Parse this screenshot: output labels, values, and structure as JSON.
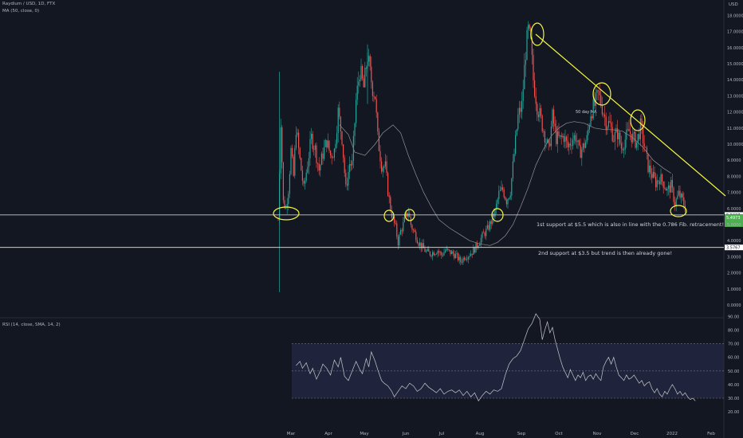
{
  "header": {
    "symbol": "Raydium / USD, 1D, FTX",
    "ma_label": "MA (50, close, 0)",
    "currency": "USD",
    "rsi_label": "RSI (14, close, SMA, 14, 2)"
  },
  "colors": {
    "up": "#26a69a",
    "down": "#ef5350",
    "background": "#131722",
    "trendline": "#f5f541",
    "ma": "#a8a8a8",
    "rsi": "#c9c9c9",
    "rsi_band": "#2a2e52",
    "price_badge": "#4caf50"
  },
  "chart_data": [
    {
      "type": "candlestick",
      "x_ticks": [
        "Mar",
        "Apr",
        "May",
        "Jun",
        "Jul",
        "Aug",
        "Sep",
        "Oct",
        "Nov",
        "Dec",
        "2022",
        "Feb"
      ],
      "y_ticks": [
        "0.0000",
        "1.0000",
        "2.0000",
        "3.0000",
        "4.0000",
        "5.0000",
        "6.0000",
        "7.0000",
        "8.0000",
        "9.0000",
        "10.0000",
        "11.0000",
        "12.0000",
        "13.0000",
        "14.0000",
        "15.0000",
        "16.0000",
        "17.0000",
        "18.0000"
      ],
      "ylim": [
        0,
        18.5
      ],
      "close_points": [
        [
          0,
          5.3
        ],
        [
          2,
          11.5
        ],
        [
          4,
          6.4
        ],
        [
          6,
          6.0
        ],
        [
          8,
          7.2
        ],
        [
          10,
          9.6
        ],
        [
          12,
          8.0
        ],
        [
          14,
          11.0
        ],
        [
          17,
          9.0
        ],
        [
          20,
          7.2
        ],
        [
          23,
          8.8
        ],
        [
          26,
          10.4
        ],
        [
          29,
          9.7
        ],
        [
          32,
          8.4
        ],
        [
          35,
          9.4
        ],
        [
          38,
          10.2
        ],
        [
          41,
          9.3
        ],
        [
          44,
          9.6
        ],
        [
          47,
          12.0
        ],
        [
          50,
          10.4
        ],
        [
          53,
          7.2
        ],
        [
          56,
          8.8
        ],
        [
          58,
          8.7
        ],
        [
          61,
          12.7
        ],
        [
          64,
          14.6
        ],
        [
          67,
          13.5
        ],
        [
          70,
          15.5
        ],
        [
          72,
          14.4
        ],
        [
          74,
          13.5
        ],
        [
          76,
          13.0
        ],
        [
          78,
          10.4
        ],
        [
          81,
          8.7
        ],
        [
          84,
          8.6
        ],
        [
          86,
          7.1
        ],
        [
          88,
          6.0
        ],
        [
          90,
          5.3
        ],
        [
          92,
          4.8
        ],
        [
          94,
          3.9
        ],
        [
          96,
          4.6
        ],
        [
          98,
          5.0
        ],
        [
          100,
          5.5
        ],
        [
          102,
          5.8
        ],
        [
          104,
          5.0
        ],
        [
          106,
          4.6
        ],
        [
          108,
          4.3
        ],
        [
          110,
          3.9
        ],
        [
          113,
          3.6
        ],
        [
          116,
          3.3
        ],
        [
          119,
          3.2
        ],
        [
          122,
          3.3
        ],
        [
          125,
          3.4
        ],
        [
          128,
          3.1
        ],
        [
          131,
          3.4
        ],
        [
          134,
          3.3
        ],
        [
          137,
          3.2
        ],
        [
          140,
          3.0
        ],
        [
          143,
          2.7
        ],
        [
          146,
          3.0
        ],
        [
          149,
          3.1
        ],
        [
          152,
          3.3
        ],
        [
          155,
          3.6
        ],
        [
          158,
          4.0
        ],
        [
          161,
          4.4
        ],
        [
          164,
          4.7
        ],
        [
          167,
          5.2
        ],
        [
          170,
          5.8
        ],
        [
          173,
          6.9
        ],
        [
          176,
          7.2
        ],
        [
          179,
          6.5
        ],
        [
          182,
          7.1
        ],
        [
          185,
          9.4
        ],
        [
          188,
          11.7
        ],
        [
          191,
          12.4
        ],
        [
          194,
          15.8
        ],
        [
          196,
          17.0
        ],
        [
          198,
          16.2
        ],
        [
          200,
          14.0
        ],
        [
          203,
          12.4
        ],
        [
          206,
          11.5
        ],
        [
          209,
          10.6
        ],
        [
          212,
          9.6
        ],
        [
          215,
          11.7
        ],
        [
          218,
          10.4
        ],
        [
          221,
          10.3
        ],
        [
          224,
          10.5
        ],
        [
          227,
          9.8
        ],
        [
          230,
          10.3
        ],
        [
          233,
          10.5
        ],
        [
          236,
          9.5
        ],
        [
          239,
          9.8
        ],
        [
          242,
          10.3
        ],
        [
          245,
          12.0
        ],
        [
          248,
          12.4
        ],
        [
          251,
          13.1
        ],
        [
          254,
          12.3
        ],
        [
          257,
          11.4
        ],
        [
          260,
          11.2
        ],
        [
          263,
          10.4
        ],
        [
          266,
          10.7
        ],
        [
          269,
          9.8
        ],
        [
          272,
          10.3
        ],
        [
          275,
          10.8
        ],
        [
          278,
          10.4
        ],
        [
          281,
          10.1
        ],
        [
          284,
          11.1
        ],
        [
          287,
          9.9
        ],
        [
          290,
          8.6
        ],
        [
          293,
          8.1
        ],
        [
          296,
          7.6
        ],
        [
          299,
          7.9
        ],
        [
          302,
          7.6
        ],
        [
          305,
          7.1
        ],
        [
          308,
          7.4
        ],
        [
          311,
          6.3
        ],
        [
          314,
          6.9
        ],
        [
          317,
          6.5
        ],
        [
          320,
          5.8
        ]
      ],
      "ma50": [
        [
          48,
          11.2
        ],
        [
          55,
          10.6
        ],
        [
          60,
          9.5
        ],
        [
          68,
          9.3
        ],
        [
          76,
          10.0
        ],
        [
          82,
          10.7
        ],
        [
          90,
          11.2
        ],
        [
          96,
          10.7
        ],
        [
          102,
          9.3
        ],
        [
          108,
          8.1
        ],
        [
          114,
          7.0
        ],
        [
          120,
          6.1
        ],
        [
          126,
          5.3
        ],
        [
          134,
          4.8
        ],
        [
          142,
          4.4
        ],
        [
          150,
          4.0
        ],
        [
          158,
          3.8
        ],
        [
          166,
          3.7
        ],
        [
          172,
          3.9
        ],
        [
          178,
          4.3
        ],
        [
          184,
          5.0
        ],
        [
          190,
          6.1
        ],
        [
          196,
          7.3
        ],
        [
          202,
          8.7
        ],
        [
          208,
          9.7
        ],
        [
          214,
          10.5
        ],
        [
          220,
          11.0
        ],
        [
          226,
          11.3
        ],
        [
          232,
          11.4
        ],
        [
          240,
          11.3
        ],
        [
          248,
          11.0
        ],
        [
          256,
          10.9
        ],
        [
          262,
          10.9
        ],
        [
          270,
          10.8
        ],
        [
          278,
          10.4
        ],
        [
          286,
          9.8
        ],
        [
          294,
          9.0
        ],
        [
          302,
          8.5
        ],
        [
          308,
          8.2
        ]
      ],
      "ma_label": "50 day MA",
      "supports": [
        {
          "price_label": "5.5987",
          "text": "1st support at $5.5 which is also in line with the 0.786 Fib. retracement!"
        },
        {
          "price_label": "3.5767",
          "text": "2nd support at $3.5 but trend is then already gone!"
        }
      ],
      "last_price": "5.4973"
    },
    {
      "type": "line",
      "title": "RSI (14, close, SMA, 14, 2)",
      "y_ticks": [
        "20.00",
        "30.00",
        "40.00",
        "50.00",
        "60.00",
        "70.00",
        "80.00",
        "90.00"
      ],
      "ylim": [
        20,
        95
      ],
      "levels": [
        30,
        50,
        70
      ],
      "values": [
        [
          0,
          54
        ],
        [
          3,
          57
        ],
        [
          5,
          52
        ],
        [
          8,
          56
        ],
        [
          11,
          48
        ],
        [
          13,
          52
        ],
        [
          16,
          44
        ],
        [
          19,
          50
        ],
        [
          21,
          55
        ],
        [
          24,
          52
        ],
        [
          27,
          47
        ],
        [
          30,
          58
        ],
        [
          33,
          53
        ],
        [
          35,
          60
        ],
        [
          38,
          46
        ],
        [
          41,
          43
        ],
        [
          44,
          50
        ],
        [
          47,
          57
        ],
        [
          50,
          51
        ],
        [
          52,
          48
        ],
        [
          55,
          59
        ],
        [
          57,
          53
        ],
        [
          59,
          64
        ],
        [
          62,
          57
        ],
        [
          64,
          51
        ],
        [
          67,
          43
        ],
        [
          69,
          41
        ],
        [
          72,
          39
        ],
        [
          75,
          35
        ],
        [
          77,
          31
        ],
        [
          80,
          35
        ],
        [
          83,
          39
        ],
        [
          86,
          37
        ],
        [
          89,
          41
        ],
        [
          92,
          39
        ],
        [
          95,
          35
        ],
        [
          98,
          37
        ],
        [
          101,
          41
        ],
        [
          104,
          38
        ],
        [
          107,
          36
        ],
        [
          110,
          34
        ],
        [
          113,
          37
        ],
        [
          116,
          33
        ],
        [
          119,
          35
        ],
        [
          122,
          36
        ],
        [
          125,
          34
        ],
        [
          128,
          36
        ],
        [
          131,
          32
        ],
        [
          134,
          35
        ],
        [
          137,
          31
        ],
        [
          140,
          34
        ],
        [
          143,
          28
        ],
        [
          146,
          32
        ],
        [
          149,
          35
        ],
        [
          152,
          33
        ],
        [
          155,
          36
        ],
        [
          158,
          35
        ],
        [
          161,
          37
        ],
        [
          164,
          47
        ],
        [
          167,
          55
        ],
        [
          170,
          59
        ],
        [
          173,
          61
        ],
        [
          176,
          65
        ],
        [
          179,
          73
        ],
        [
          182,
          81
        ],
        [
          185,
          85
        ],
        [
          188,
          92
        ],
        [
          191,
          88
        ],
        [
          193,
          73
        ],
        [
          195,
          80
        ],
        [
          197,
          86
        ],
        [
          199,
          78
        ],
        [
          201,
          82
        ],
        [
          203,
          73
        ],
        [
          205,
          66
        ],
        [
          207,
          59
        ],
        [
          209,
          53
        ],
        [
          211,
          49
        ],
        [
          213,
          45
        ],
        [
          215,
          51
        ],
        [
          217,
          47
        ],
        [
          219,
          43
        ],
        [
          221,
          47
        ],
        [
          223,
          45
        ],
        [
          225,
          49
        ],
        [
          227,
          43
        ],
        [
          229,
          46
        ],
        [
          231,
          47
        ],
        [
          233,
          44
        ],
        [
          235,
          48
        ],
        [
          237,
          45
        ],
        [
          239,
          43
        ],
        [
          241,
          53
        ],
        [
          243,
          57
        ],
        [
          245,
          60
        ],
        [
          247,
          55
        ],
        [
          249,
          60
        ],
        [
          251,
          53
        ],
        [
          253,
          47
        ],
        [
          255,
          45
        ],
        [
          257,
          43
        ],
        [
          259,
          47
        ],
        [
          261,
          44
        ],
        [
          263,
          45
        ],
        [
          265,
          47
        ],
        [
          267,
          44
        ],
        [
          269,
          41
        ],
        [
          271,
          43
        ],
        [
          273,
          39
        ],
        [
          275,
          41
        ],
        [
          277,
          42
        ],
        [
          279,
          37
        ],
        [
          281,
          34
        ],
        [
          283,
          37
        ],
        [
          285,
          33
        ],
        [
          287,
          31
        ],
        [
          289,
          35
        ],
        [
          291,
          33
        ],
        [
          293,
          37
        ],
        [
          295,
          40
        ],
        [
          297,
          37
        ],
        [
          299,
          33
        ],
        [
          301,
          35
        ],
        [
          303,
          32
        ],
        [
          305,
          34
        ],
        [
          307,
          31
        ],
        [
          309,
          29
        ],
        [
          311,
          30
        ],
        [
          313,
          28
        ]
      ]
    }
  ]
}
